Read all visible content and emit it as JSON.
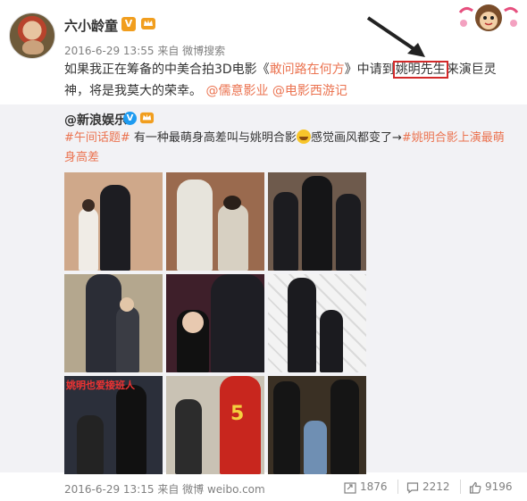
{
  "post": {
    "author": "六小龄童",
    "verified_badge": "V",
    "time": "2016-6-29 13:55",
    "source_prefix": "来自",
    "source": "微博搜索",
    "text_before": "如果我正在筹备的中美合拍3D电影《",
    "movie_title": "敢问路在何方",
    "text_mid": "》中请到",
    "highlight": "姚明先生",
    "text_after": "来演巨灵神，将是我莫大的荣幸。",
    "mention_1": "@儒意影业",
    "mention_2": "@电影西游记"
  },
  "repost": {
    "author": "@新浪娱乐",
    "topic": "#午间话题#",
    "text_1": " 有一种最萌身高差叫与姚明合影",
    "text_2": "感觉画风都变了→",
    "topic_2": "#姚明合影上演最萌身高差",
    "caption": "姚明也爱接班人",
    "time": "2016-6-29 13:15",
    "source_prefix": "来自",
    "source": "微博 weibo.com"
  },
  "stats": {
    "reposts": "1876",
    "comments": "2212",
    "likes": "9196"
  },
  "colors": {
    "accent": "#eb7350",
    "highlight_box": "#d32a2a",
    "verified_gold": "#f19e1e",
    "verified_blue": "#1e9bf0",
    "repost_bg": "#f2f2f5"
  },
  "icons": {
    "repost": "repost-icon",
    "comment": "comment-icon",
    "like": "thumbs-up-icon"
  }
}
